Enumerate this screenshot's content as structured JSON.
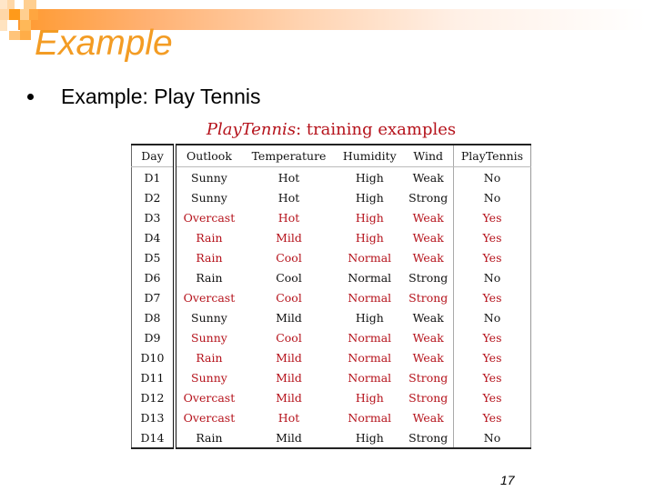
{
  "slide": {
    "title": "Example",
    "bullet": "Example: Play Tennis",
    "page_number": "17",
    "accent_color": "#f39c24"
  },
  "table": {
    "caption_italic": "PlayTennis",
    "caption_rest": ": training examples",
    "positive_color": "#b5121b",
    "headers": [
      "Day",
      "Outlook",
      "Temperature",
      "Humidity",
      "Wind",
      "PlayTennis"
    ],
    "rows": [
      {
        "day": "D1",
        "outlook": "Sunny",
        "temperature": "Hot",
        "humidity": "High",
        "wind": "Weak",
        "play": "No"
      },
      {
        "day": "D2",
        "outlook": "Sunny",
        "temperature": "Hot",
        "humidity": "High",
        "wind": "Strong",
        "play": "No"
      },
      {
        "day": "D3",
        "outlook": "Overcast",
        "temperature": "Hot",
        "humidity": "High",
        "wind": "Weak",
        "play": "Yes"
      },
      {
        "day": "D4",
        "outlook": "Rain",
        "temperature": "Mild",
        "humidity": "High",
        "wind": "Weak",
        "play": "Yes"
      },
      {
        "day": "D5",
        "outlook": "Rain",
        "temperature": "Cool",
        "humidity": "Normal",
        "wind": "Weak",
        "play": "Yes"
      },
      {
        "day": "D6",
        "outlook": "Rain",
        "temperature": "Cool",
        "humidity": "Normal",
        "wind": "Strong",
        "play": "No"
      },
      {
        "day": "D7",
        "outlook": "Overcast",
        "temperature": "Cool",
        "humidity": "Normal",
        "wind": "Strong",
        "play": "Yes"
      },
      {
        "day": "D8",
        "outlook": "Sunny",
        "temperature": "Mild",
        "humidity": "High",
        "wind": "Weak",
        "play": "No"
      },
      {
        "day": "D9",
        "outlook": "Sunny",
        "temperature": "Cool",
        "humidity": "Normal",
        "wind": "Weak",
        "play": "Yes"
      },
      {
        "day": "D10",
        "outlook": "Rain",
        "temperature": "Mild",
        "humidity": "Normal",
        "wind": "Weak",
        "play": "Yes"
      },
      {
        "day": "D11",
        "outlook": "Sunny",
        "temperature": "Mild",
        "humidity": "Normal",
        "wind": "Strong",
        "play": "Yes"
      },
      {
        "day": "D12",
        "outlook": "Overcast",
        "temperature": "Mild",
        "humidity": "High",
        "wind": "Strong",
        "play": "Yes"
      },
      {
        "day": "D13",
        "outlook": "Overcast",
        "temperature": "Hot",
        "humidity": "Normal",
        "wind": "Weak",
        "play": "Yes"
      },
      {
        "day": "D14",
        "outlook": "Rain",
        "temperature": "Mild",
        "humidity": "High",
        "wind": "Strong",
        "play": "No"
      }
    ]
  }
}
